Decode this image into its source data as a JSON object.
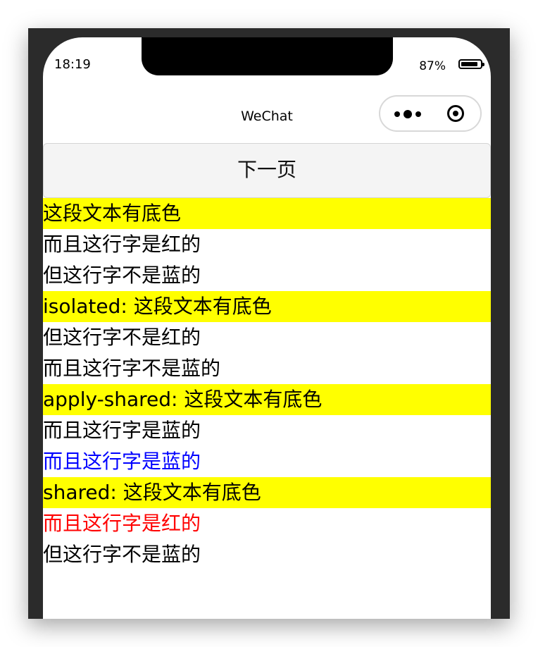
{
  "status_bar": {
    "time": "18:19",
    "battery_percent": "87%",
    "battery_level": 0.87
  },
  "nav_bar": {
    "title": "WeChat",
    "menu_icon": "more-dots-icon",
    "close_icon": "target-circle-icon"
  },
  "next_button": {
    "label": "下一页"
  },
  "lines": [
    {
      "text": "这段文本有底色",
      "highlight": true,
      "color": "#000000"
    },
    {
      "text": "而且这行字是红的",
      "highlight": false,
      "color": "#000000"
    },
    {
      "text": "但这行字不是蓝的",
      "highlight": false,
      "color": "#000000"
    },
    {
      "text": "isolated: 这段文本有底色",
      "highlight": true,
      "color": "#000000"
    },
    {
      "text": "但这行字不是红的",
      "highlight": false,
      "color": "#000000"
    },
    {
      "text": "而且这行字不是蓝的",
      "highlight": false,
      "color": "#000000"
    },
    {
      "text": "apply-shared: 这段文本有底色",
      "highlight": true,
      "color": "#000000"
    },
    {
      "text": "而且这行字是蓝的",
      "highlight": false,
      "color": "#000000"
    },
    {
      "text": "而且这行字是蓝的",
      "highlight": false,
      "color": "#0000ff"
    },
    {
      "text": "shared: 这段文本有底色",
      "highlight": true,
      "color": "#000000"
    },
    {
      "text": "而且这行字是红的",
      "highlight": false,
      "color": "#ff0000"
    },
    {
      "text": "但这行字不是蓝的",
      "highlight": false,
      "color": "#000000"
    }
  ],
  "colors": {
    "highlight": "#ffff00",
    "red": "#ff0000",
    "blue": "#0000ff"
  }
}
